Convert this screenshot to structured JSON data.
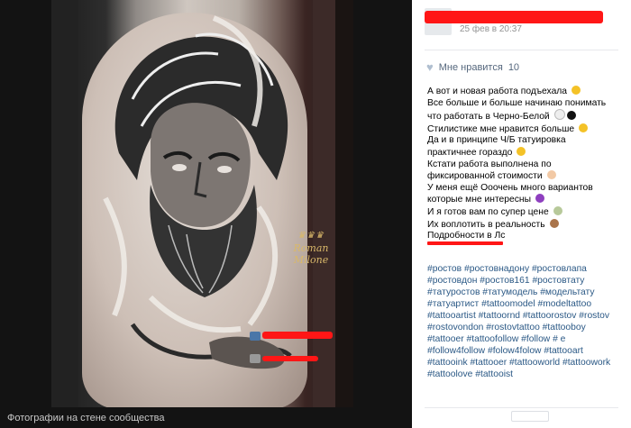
{
  "photo": {
    "watermark_lines": [
      "Roman",
      "Milone"
    ],
    "caption": "Фотографии на стене сообщества"
  },
  "post": {
    "date": "25 фев в 20:37",
    "likes_label": "Мне нравится",
    "likes_count": "10",
    "text_lines": [
      "А вот и новая работа подъехала",
      "Все больше и больше начинаю понимать",
      "что работать в Черно-Белой",
      "Стилистике мне нравится больше",
      "Да и в принципе Ч/Б татуировка",
      "практичнее гораздо",
      "Кстати работа выполнена по",
      "фиксированной стоимости",
      "У меня ещё Ооочень много вариантов",
      "которые мне интересны",
      "И я готов вам по супер цене",
      "Их воплотить в реальность",
      "Подробности в Лс"
    ],
    "hashtag_lines": [
      "#ростов #ростовнадону #ростовлапа",
      "#ростовдон #ростов161 #ростовтату",
      "#тaтуростов #татумодель #модельтату",
      "#татуартист #tattoomodel #modeltattoo",
      "#tattooartist #tattoornd #tattoorostov #rostov",
      "#rostovondon #rostovtattoo #tattooboy",
      "#tattooer #tattoofollow #follow # e",
      "#follow4follow #folow4folow #tattooart",
      "#tattooink #tattooer #tattooworld #tattoowork",
      "#tattoolove #tattooist"
    ]
  },
  "colors": {
    "redaction": "#ff1616",
    "link": "#2a5885",
    "likes_text": "#55677d"
  }
}
